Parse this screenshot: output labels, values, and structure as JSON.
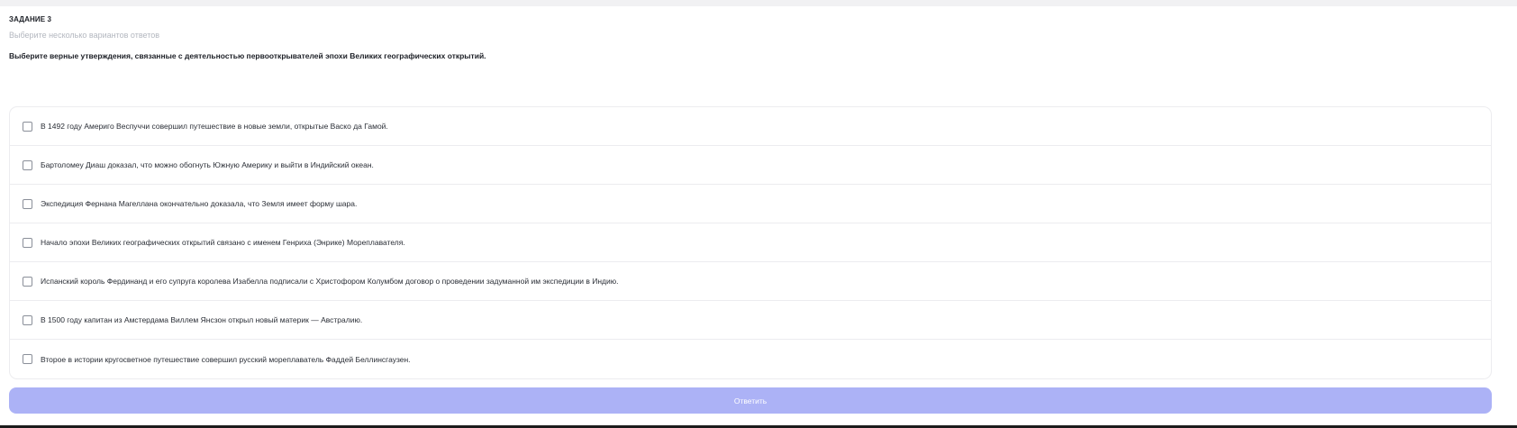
{
  "task": {
    "label": "ЗАДАНИЕ 3",
    "hint": "Выберите несколько вариантов ответов",
    "question": "Выберите верные утверждения, связанные с деятельностью первооткрывателей эпохи Великих географических открытий."
  },
  "options": [
    {
      "text": "В 1492 году Америго Веспуччи совершил путешествие в новые земли, открытые Васко да Гамой.",
      "checked": false
    },
    {
      "text": "Бартоломеу Диаш доказал, что можно обогнуть Южную Америку и выйти в Индийский океан.",
      "checked": false
    },
    {
      "text": "Экспедиция Фернана Магеллана окончательно доказала, что Земля имеет форму шара.",
      "checked": false
    },
    {
      "text": "Начало эпохи Великих географических открытий связано с именем Генриха (Энрике) Мореплавателя.",
      "checked": false
    },
    {
      "text": "Испанский король Фердинанд и его супруга королева Изабелла подписали с Христофором Колумбом договор о проведении задуманной им экспедиции в Индию.",
      "checked": false
    },
    {
      "text": "В 1500 году капитан из Амстердама Виллем Янсзон открыл новый материк — Австралию.",
      "checked": false
    },
    {
      "text": "Второе в истории кругосветное путешествие совершил русский мореплаватель Фаддей Беллинсгаузен.",
      "checked": false
    }
  ],
  "submit": {
    "label": "Ответить"
  },
  "colors": {
    "submit_bg": "#acb2f6",
    "border": "#ececef",
    "hint": "#b3b7bf"
  }
}
